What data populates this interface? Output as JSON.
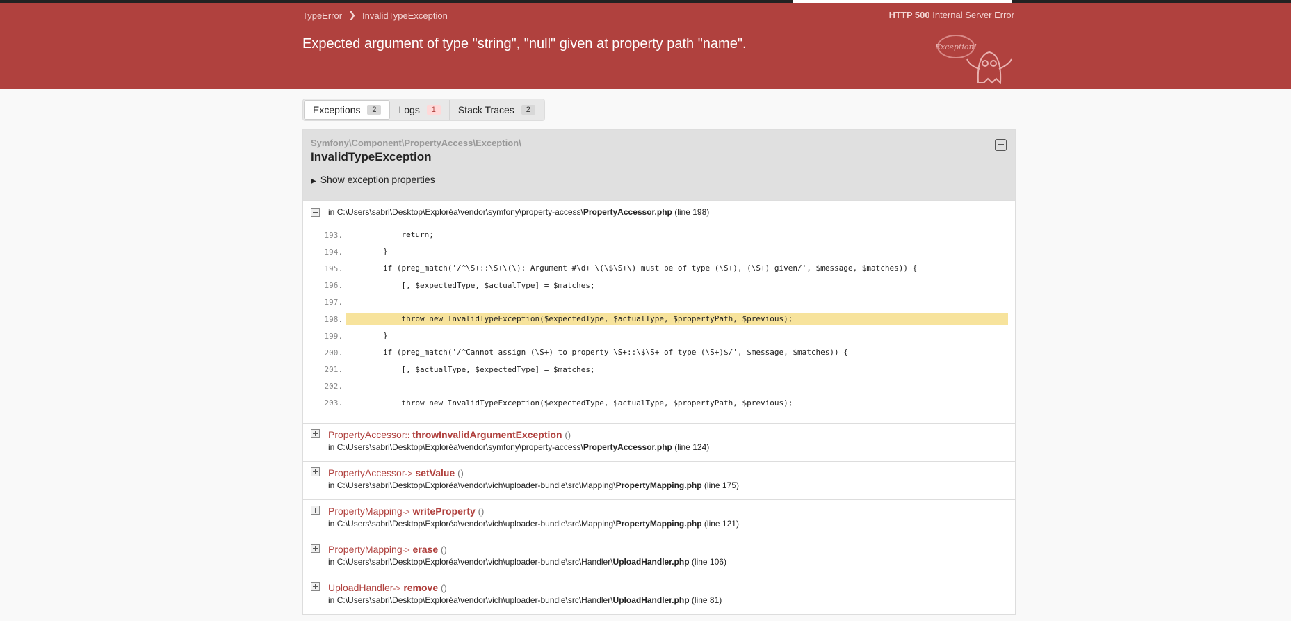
{
  "header": {
    "breadcrumb": [
      "TypeError",
      "InvalidTypeException"
    ],
    "status_code": "HTTP 500",
    "status_text": "Internal Server Error",
    "message": "Expected argument of type \"string\", \"null\" given at property path \"name\".",
    "logo_text": "Exception!",
    "accent_color": "#b0413e"
  },
  "loading_progress": 0.42,
  "tabs": [
    {
      "label": "Exceptions",
      "count": "2"
    },
    {
      "label": "Logs",
      "count": "1"
    },
    {
      "label": "Stack Traces",
      "count": "2"
    }
  ],
  "exception": {
    "namespace": "Symfony\\Component\\PropertyAccess\\Exception\\",
    "class": "InvalidTypeException",
    "properties_toggle": "Show exception properties"
  },
  "first_frame": {
    "in": "in ",
    "path": "C:\\Users\\sabri\\Desktop\\Exploréa\\vendor\\symfony\\property-access\\",
    "file": "PropertyAccessor.php",
    "line": "(line 198)"
  },
  "code": [
    {
      "n": "193.",
      "src": "            return;"
    },
    {
      "n": "194.",
      "src": "        }"
    },
    {
      "n": "195.",
      "src": "        if (preg_match('/^\\S+::\\S+\\(\\): Argument #\\d+ \\(\\$\\S+\\) must be of type (\\S+), (\\S+) given/', $message, $matches)) {"
    },
    {
      "n": "196.",
      "src": "            [, $expectedType, $actualType] = $matches;"
    },
    {
      "n": "197.",
      "src": ""
    },
    {
      "n": "198.",
      "src": "            throw new InvalidTypeException($expectedType, $actualType, $propertyPath, $previous);"
    },
    {
      "n": "199.",
      "src": "        }"
    },
    {
      "n": "200.",
      "src": "        if (preg_match('/^Cannot assign (\\S+) to property \\S+::\\$\\S+ of type (\\S+)$/', $message, $matches)) {"
    },
    {
      "n": "201.",
      "src": "            [, $actualType, $expectedType] = $matches;"
    },
    {
      "n": "202.",
      "src": ""
    },
    {
      "n": "203.",
      "src": "            throw new InvalidTypeException($expectedType, $actualType, $propertyPath, $previous);"
    }
  ],
  "frames": [
    {
      "class": "PropertyAccessor",
      "sep": "::",
      "method": "throwInvalidArgumentException",
      "paren": "()",
      "path": "C:\\Users\\sabri\\Desktop\\Exploréa\\vendor\\symfony\\property-access\\",
      "file": "PropertyAccessor.php",
      "line": "(line 124)"
    },
    {
      "class": "PropertyAccessor",
      "sep": "->",
      "method": "setValue",
      "paren": "()",
      "path": "C:\\Users\\sabri\\Desktop\\Exploréa\\vendor\\vich\\uploader-bundle\\src\\Mapping\\",
      "file": "PropertyMapping.php",
      "line": "(line 175)"
    },
    {
      "class": "PropertyMapping",
      "sep": "->",
      "method": "writeProperty",
      "paren": "()",
      "path": "C:\\Users\\sabri\\Desktop\\Exploréa\\vendor\\vich\\uploader-bundle\\src\\Mapping\\",
      "file": "PropertyMapping.php",
      "line": "(line 121)"
    },
    {
      "class": "PropertyMapping",
      "sep": "->",
      "method": "erase",
      "paren": "()",
      "path": "C:\\Users\\sabri\\Desktop\\Exploréa\\vendor\\vich\\uploader-bundle\\src\\Handler\\",
      "file": "UploadHandler.php",
      "line": "(line 106)"
    },
    {
      "class": "UploadHandler",
      "sep": "->",
      "method": "remove",
      "paren": "()",
      "path": "C:\\Users\\sabri\\Desktop\\Exploréa\\vendor\\vich\\uploader-bundle\\src\\Handler\\",
      "file": "UploadHandler.php",
      "line": "(line 81)"
    }
  ]
}
